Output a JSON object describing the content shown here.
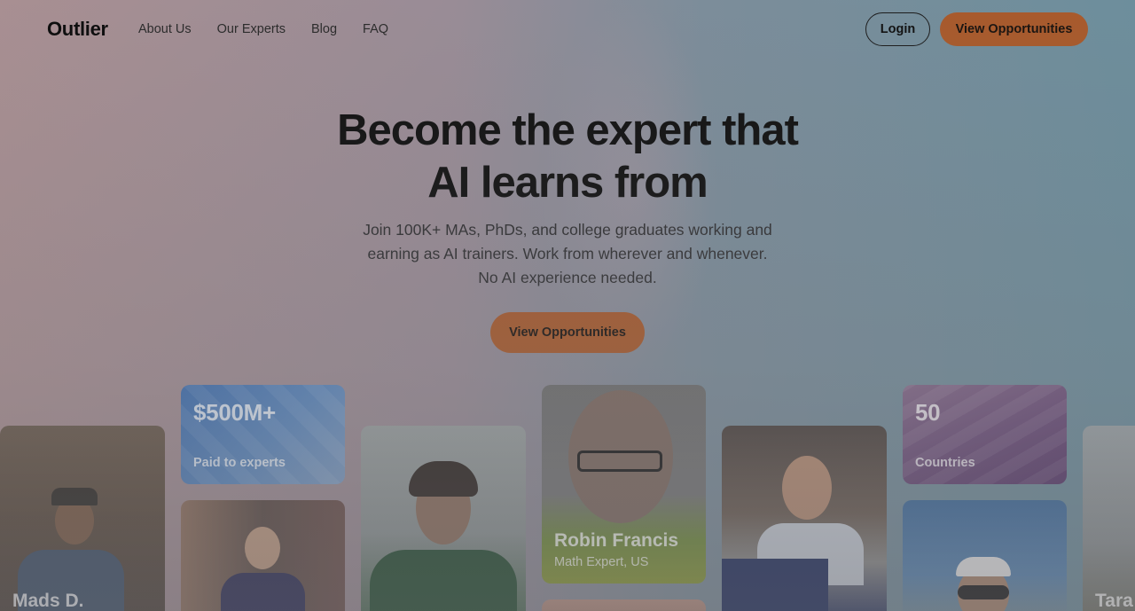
{
  "nav": {
    "logo": "Outlier",
    "links": [
      "About Us",
      "Our Experts",
      "Blog",
      "FAQ"
    ],
    "login_label": "Login",
    "cta_label": "View Opportunities"
  },
  "hero": {
    "title_line1": "Become the expert that",
    "title_line2": "AI learns from",
    "sub_line1": "Join 100K+ MAs, PhDs, and college graduates working and",
    "sub_line2": "earning as AI trainers. Work from wherever and whenever.",
    "sub_line3": "No AI experience needed.",
    "cta_label": "View Opportunities"
  },
  "stats": [
    {
      "value": "$500M+",
      "label": "Paid to experts"
    },
    {
      "value": "50",
      "label": "Countries"
    }
  ],
  "experts": [
    {
      "name": "Mads D.",
      "role": ""
    },
    {
      "name": "Robin Francis",
      "role": "Math Expert, US"
    },
    {
      "name": "Tara",
      "role": ""
    }
  ],
  "colors": {
    "accent": "#a85a2c",
    "text": "#0f0f0f"
  }
}
